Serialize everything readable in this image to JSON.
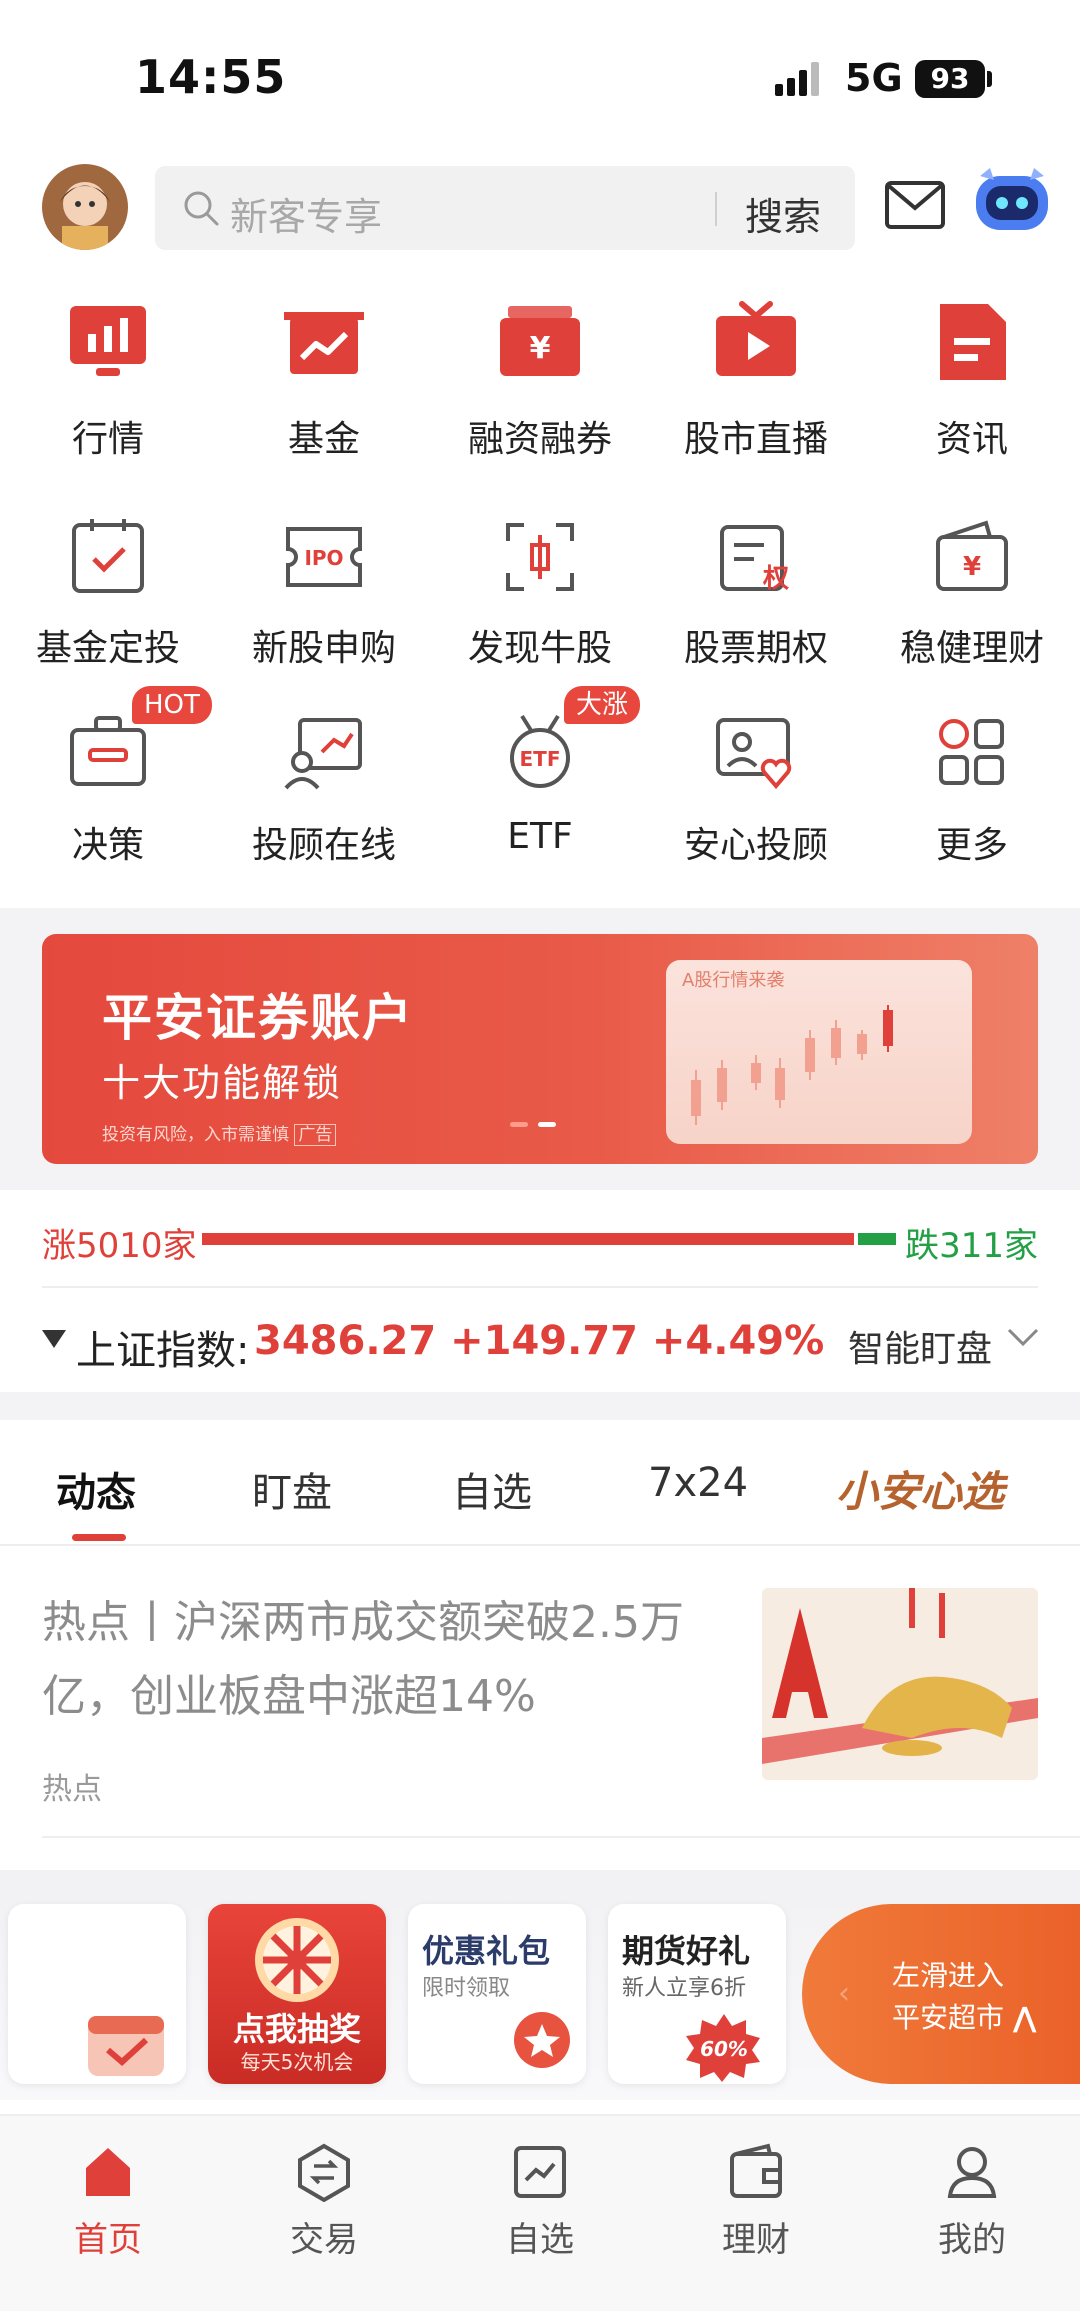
{
  "status_bar": {
    "time": "14:55",
    "network": "5G",
    "battery": "93"
  },
  "header": {
    "search_placeholder": "新客专享",
    "search_button": "搜索"
  },
  "grid": {
    "row1": [
      "行情",
      "基金",
      "融资融券",
      "股市直播",
      "资讯"
    ],
    "row2": [
      "基金定投",
      "新股申购",
      "发现牛股",
      "股票期权",
      "稳健理财"
    ],
    "row3": [
      "决策",
      "投顾在线",
      "ETF",
      "安心投顾",
      "更多"
    ],
    "badges": {
      "hot": "HOT",
      "rise": "大涨"
    },
    "icon_text": {
      "ipo": "IPO",
      "yen": "¥",
      "quan": "权",
      "etf": "ETF"
    }
  },
  "banner": {
    "title": "平安证券账户",
    "subtitle": "十大功能解锁",
    "note": "投资有风险，入市需谨慎",
    "ad_tag": "广告",
    "card_title": "A股行情来袭",
    "slide_count": 2,
    "active_slide": 2
  },
  "market": {
    "up_label": "涨5010家",
    "down_label": "跌311家",
    "up_count": 5010,
    "down_count": 311,
    "index_name": "上证指数:",
    "index_value": "3486.27 +149.77 +4.49%",
    "smart_watch": "智能盯盘"
  },
  "tabs": [
    "动态",
    "盯盘",
    "自选",
    "7x24",
    "小安心选"
  ],
  "active_tab": "动态",
  "news": {
    "headline": "热点丨沪深两市成交额突破2.5万亿，创业板盘中涨超14%",
    "tag": "热点"
  },
  "float_cards": {
    "lottery_title": "点我抽奖",
    "lottery_sub": "每天5次机会",
    "gift_title": "优惠礼包",
    "gift_sub": "限时领取",
    "futures_title": "期货好礼",
    "futures_sub": "新人立享6折",
    "futures_badge": "60%",
    "slide_line1": "左滑进入",
    "slide_line2": "平安超市"
  },
  "bottom_nav": [
    "首页",
    "交易",
    "自选",
    "理财",
    "我的"
  ],
  "active_nav": "首页",
  "colors": {
    "brand_red": "#e0403a",
    "up_red": "#e0403a",
    "down_green": "#23a046",
    "special_tab": "#b5622e"
  }
}
